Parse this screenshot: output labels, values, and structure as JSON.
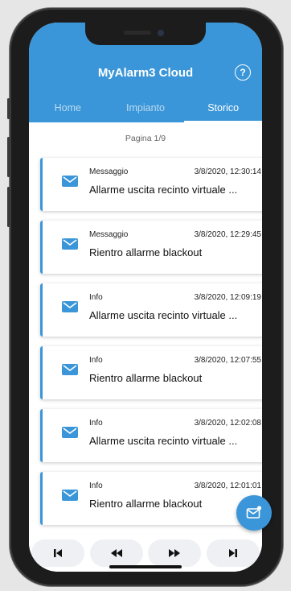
{
  "app": {
    "title": "MyAlarm3 Cloud"
  },
  "tabs": [
    {
      "label": "Home",
      "active": false
    },
    {
      "label": "Impianto",
      "active": false
    },
    {
      "label": "Storico",
      "active": true
    }
  ],
  "page_label": "Pagina 1/9",
  "events": [
    {
      "type": "Messaggio",
      "time": "3/8/2020, 12:30:14",
      "message": "Allarme uscita recinto virtuale ..."
    },
    {
      "type": "Messaggio",
      "time": "3/8/2020, 12:29:45",
      "message": "Rientro allarme blackout"
    },
    {
      "type": "Info",
      "time": "3/8/2020, 12:09:19",
      "message": "Allarme uscita recinto virtuale ..."
    },
    {
      "type": "Info",
      "time": "3/8/2020, 12:07:55",
      "message": "Rientro allarme blackout"
    },
    {
      "type": "Info",
      "time": "3/8/2020, 12:02:08",
      "message": "Allarme uscita recinto virtuale ..."
    },
    {
      "type": "Info",
      "time": "3/8/2020, 12:01:01",
      "message": "Rientro allarme blackout"
    }
  ],
  "icons": {
    "help": "help-circle-icon",
    "event": "mail-icon",
    "fab": "mail-notification-icon",
    "pager": [
      "skip-first-icon",
      "rewind-icon",
      "fast-forward-icon",
      "skip-last-icon"
    ]
  },
  "colors": {
    "accent": "#3a96d8",
    "card_border": "#3a96d8",
    "pager_bg": "#eef0f3"
  }
}
